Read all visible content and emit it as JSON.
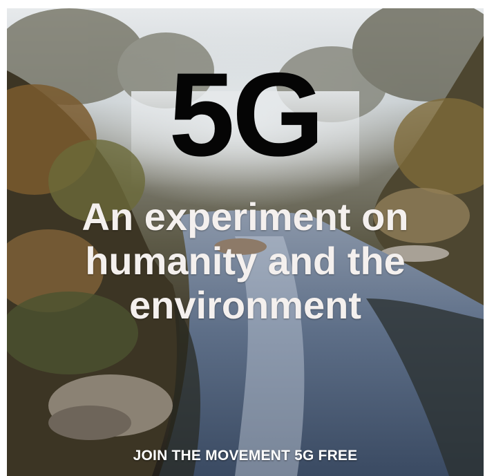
{
  "poster": {
    "title": "5G",
    "tagline_lines": [
      "An experiment on",
      "humanity and the",
      "environment"
    ],
    "footer": "JOIN THE MOVEMENT 5G FREE"
  },
  "colors": {
    "title": "#050505",
    "tagline": "#f4f0ee",
    "footer": "#ffffff",
    "water": "#6f7f96",
    "foliage": "#4a4a2c"
  }
}
